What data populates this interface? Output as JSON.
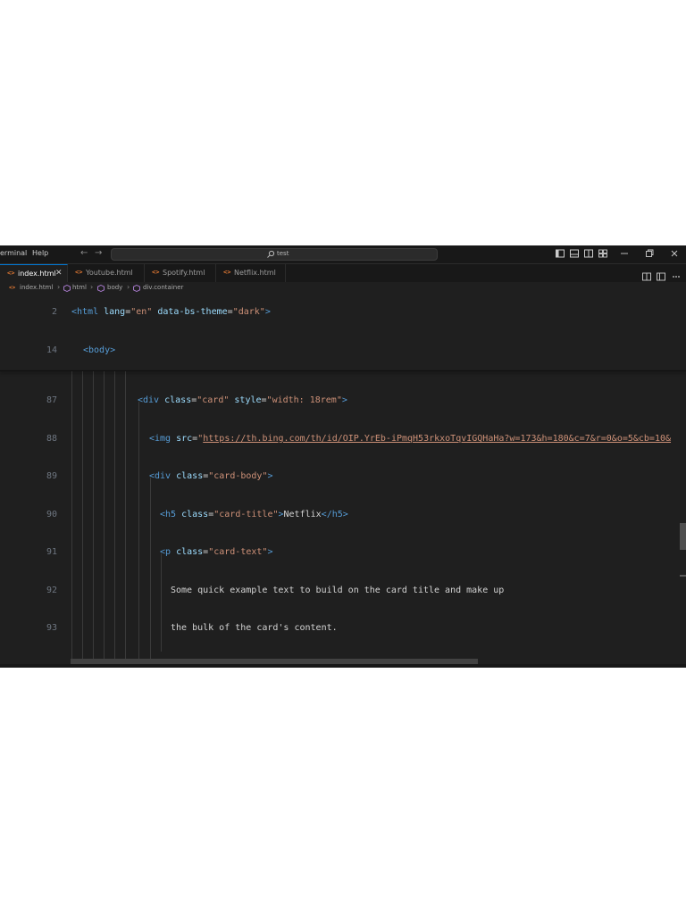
{
  "menu": {
    "items": [
      "erminal",
      "Help"
    ]
  },
  "search": {
    "text": "test"
  },
  "tabs": [
    {
      "label": "index.html",
      "active": true
    },
    {
      "label": "Youtube.html",
      "active": false
    },
    {
      "label": "Spotify.html",
      "active": false
    },
    {
      "label": "Netflix.html",
      "active": false
    }
  ],
  "tab_close": "✕",
  "tab_icon": "<>",
  "breadcrumb": [
    "index.html",
    "html",
    "body",
    "div.container"
  ],
  "editor": {
    "lines": [
      {
        "num": "2",
        "tokens": [
          [
            "tag",
            "<html "
          ],
          [
            "attr",
            "lang"
          ],
          [
            "txt",
            "="
          ],
          [
            "str",
            "\"en\""
          ],
          [
            "txt",
            " "
          ],
          [
            "attr",
            "data-bs-theme"
          ],
          [
            "txt",
            "="
          ],
          [
            "str",
            "\"dark\""
          ],
          [
            "tag",
            ">"
          ]
        ]
      },
      {
        "num": "14",
        "tokens": [
          [
            "tag",
            "<body>"
          ]
        ]
      },
      {
        "num": "87",
        "tokens": [
          [
            "tag",
            "<div "
          ],
          [
            "attr",
            "class"
          ],
          [
            "txt",
            "="
          ],
          [
            "str",
            "\"card\""
          ],
          [
            "txt",
            " "
          ],
          [
            "attr",
            "style"
          ],
          [
            "txt",
            "="
          ],
          [
            "str",
            "\"width: 18rem\""
          ],
          [
            "tag",
            ">"
          ]
        ]
      },
      {
        "num": "88",
        "tokens": [
          [
            "tag",
            "<img "
          ],
          [
            "attr",
            "src"
          ],
          [
            "txt",
            "="
          ],
          [
            "str",
            "\""
          ],
          [
            "link",
            "https://th.bing.com/th/id/OIP.YrEb-iPmqH53rkxoTqvIGQHaHa?w=173&h=180&c=7&r=0&o=5&cb=10&"
          ]
        ]
      },
      {
        "num": "89",
        "tokens": [
          [
            "tag",
            "<div "
          ],
          [
            "attr",
            "class"
          ],
          [
            "txt",
            "="
          ],
          [
            "str",
            "\"card-body\""
          ],
          [
            "tag",
            ">"
          ]
        ]
      },
      {
        "num": "90",
        "tokens": [
          [
            "tag",
            "<h5 "
          ],
          [
            "attr",
            "class"
          ],
          [
            "txt",
            "="
          ],
          [
            "str",
            "\"card-title\""
          ],
          [
            "tag",
            ">"
          ],
          [
            "txt",
            "Netflix"
          ],
          [
            "tag",
            "</h5>"
          ]
        ]
      },
      {
        "num": "91",
        "tokens": [
          [
            "tag",
            "<p "
          ],
          [
            "attr",
            "class"
          ],
          [
            "txt",
            "="
          ],
          [
            "str",
            "\"card-text\""
          ],
          [
            "tag",
            ">"
          ]
        ]
      },
      {
        "num": "92",
        "tokens": [
          [
            "txt",
            "Some quick example text to build on the card title and make up"
          ]
        ]
      },
      {
        "num": "93",
        "tokens": [
          [
            "txt",
            "the bulk of the card's content."
          ]
        ]
      }
    ]
  },
  "colors": {
    "background": "#1f1f1f",
    "tag": "#569cd6",
    "attribute": "#9cdcfe",
    "string": "#ce9178",
    "text": "#d4d4d4",
    "line_number": "#6e7681",
    "active_tab_border": "#0078d4",
    "file_icon": "#e37933"
  },
  "icons": [
    "search-icon",
    "toggle-primary-sidebar-icon",
    "toggle-panel-icon",
    "toggle-secondary-sidebar-icon",
    "customize-layout-icon",
    "minimize-icon",
    "restore-icon",
    "close-icon",
    "split-editor-icon",
    "more-actions-icon",
    "html-file-icon",
    "cube-symbol-icon"
  ]
}
